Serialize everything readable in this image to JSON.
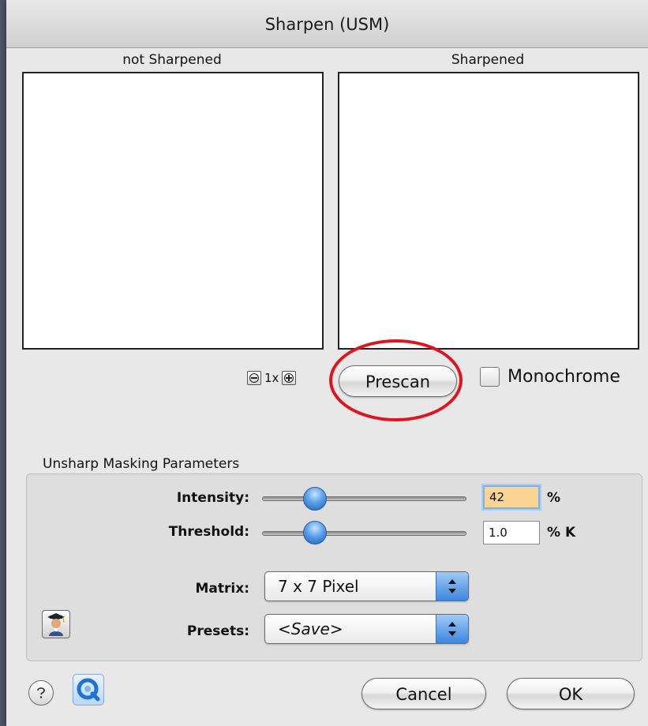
{
  "window": {
    "title": "Sharpen (USM)"
  },
  "preview": {
    "left_label": "not Sharpened",
    "right_label": "Sharpened"
  },
  "zoom": {
    "level": "1x"
  },
  "buttons": {
    "prescan": "Prescan",
    "cancel": "Cancel",
    "ok": "OK"
  },
  "monochrome": {
    "label": "Monochrome",
    "checked": false
  },
  "usm": {
    "group_title": "Unsharp Masking Parameters",
    "intensity": {
      "label": "Intensity:",
      "value": "42",
      "unit": "%",
      "slider_fraction": 0.27
    },
    "threshold": {
      "label": "Threshold:",
      "value": "1.0",
      "unit": "% K",
      "slider_fraction": 0.27
    },
    "matrix": {
      "label": "Matrix:",
      "value": "7 x 7 Pixel"
    },
    "presets": {
      "label": "Presets:",
      "value": "<Save>"
    }
  },
  "icons": {
    "profile": "scholar-avatar-icon",
    "help": "help-icon",
    "quicktime": "quicktime-icon"
  },
  "colors": {
    "highlight_ring": "#e0141e",
    "focused_field": "#fbd393",
    "slider_knob": "#3d86df"
  }
}
